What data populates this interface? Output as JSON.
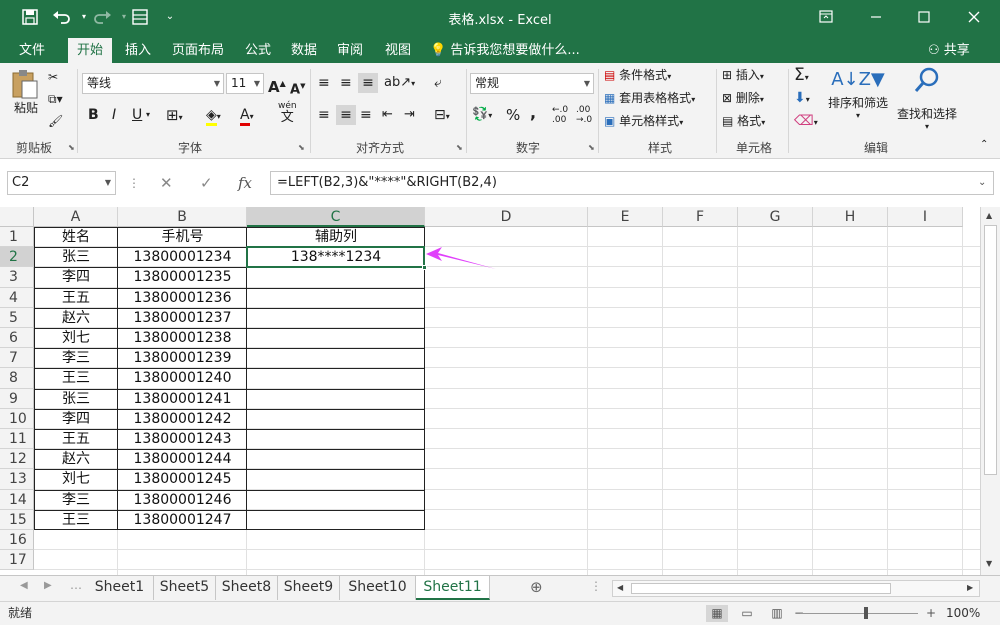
{
  "titlebar": {
    "title": "表格.xlsx - Excel",
    "save_icon": "save-icon",
    "undo_icon": "undo-icon",
    "redo_icon": "redo-icon",
    "form_icon": "form-icon",
    "customize_icon": "customize-qat-icon",
    "ribbon_display_icon": "ribbon-display-icon",
    "minimize": "minimize-icon",
    "maximize": "maximize-icon",
    "close": "close-icon"
  },
  "menu": {
    "tabs": [
      "文件",
      "开始",
      "插入",
      "页面布局",
      "公式",
      "数据",
      "审阅",
      "视图"
    ],
    "active": "开始",
    "tellme": "告诉我您想要做什么...",
    "share": "共享"
  },
  "ribbon": {
    "clipboard": {
      "paste": "粘贴",
      "label": "剪贴板"
    },
    "font": {
      "name": "等线",
      "size": "11",
      "label": "字体",
      "bold": "B",
      "italic": "I",
      "underline": "U",
      "grow": "A",
      "shrink": "A",
      "font_color": "A",
      "phonetic": "wén",
      "phonetic_char": "文"
    },
    "alignment": {
      "label": "对齐方式"
    },
    "number": {
      "format": "常规",
      "label": "数字",
      "percent": "%",
      "comma": ","
    },
    "styles": {
      "conditional": "条件格式",
      "table": "套用表格格式",
      "cell": "单元格样式",
      "label": "样式"
    },
    "cells": {
      "insert": "插入",
      "delete": "删除",
      "format": "格式",
      "label": "单元格"
    },
    "editing": {
      "sort": "排序和筛选",
      "find": "查找和选择",
      "label": "编辑",
      "sum": "Σ"
    }
  },
  "formula_bar": {
    "name_box": "C2",
    "fx": "fx",
    "formula": "=LEFT(B2,3)&\"****\"&RIGHT(B2,4)"
  },
  "grid": {
    "columns": [
      "A",
      "B",
      "C",
      "D",
      "E",
      "F",
      "G",
      "H",
      "I"
    ],
    "rows": [
      "1",
      "2",
      "3",
      "4",
      "5",
      "6",
      "7",
      "8",
      "9",
      "10",
      "11",
      "12",
      "13",
      "14",
      "15",
      "16",
      "17"
    ],
    "selected_cell": "C2",
    "data": [
      [
        "姓名",
        "手机号",
        "辅助列"
      ],
      [
        "张三",
        "13800001234",
        "138****1234"
      ],
      [
        "李四",
        "13800001235",
        ""
      ],
      [
        "王五",
        "13800001236",
        ""
      ],
      [
        "赵六",
        "13800001237",
        ""
      ],
      [
        "刘七",
        "13800001238",
        ""
      ],
      [
        "李三",
        "13800001239",
        ""
      ],
      [
        "王三",
        "13800001240",
        ""
      ],
      [
        "张三",
        "13800001241",
        ""
      ],
      [
        "李四",
        "13800001242",
        ""
      ],
      [
        "王五",
        "13800001243",
        ""
      ],
      [
        "赵六",
        "13800001244",
        ""
      ],
      [
        "刘七",
        "13800001245",
        ""
      ],
      [
        "李三",
        "13800001246",
        ""
      ],
      [
        "王三",
        "13800001247",
        ""
      ]
    ]
  },
  "sheets": {
    "tabs": [
      "Sheet1",
      "Sheet5",
      "Sheet8",
      "Sheet9",
      "Sheet10",
      "Sheet11"
    ],
    "active": "Sheet11"
  },
  "status": {
    "text": "就绪",
    "zoom": "100%"
  },
  "colors": {
    "accent": "#217346",
    "arrow": "#e040fb"
  }
}
